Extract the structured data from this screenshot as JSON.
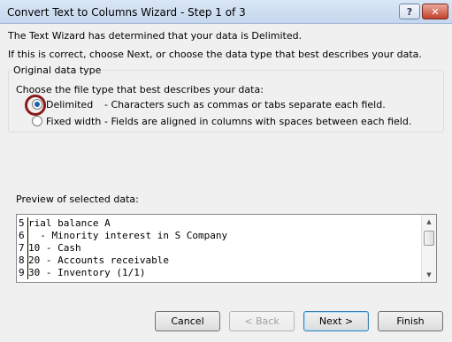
{
  "window": {
    "title": "Convert Text to Columns Wizard - Step 1 of 3",
    "help_glyph": "?",
    "close_glyph": "✕"
  },
  "intro": {
    "line1": "The Text Wizard has determined that your data is Delimited.",
    "line2": "If this is correct, choose Next, or choose the data type that best describes your data."
  },
  "data_type": {
    "legend": "Original data type",
    "prompt": "Choose the file type that best describes your data:",
    "options": [
      {
        "label": "Delimited",
        "description": "- Characters such as commas or tabs separate each field.",
        "selected": true
      },
      {
        "label": "Fixed width",
        "description": "- Fields are aligned in columns with spaces between each field.",
        "selected": false
      }
    ]
  },
  "preview": {
    "label": "Preview of selected data:",
    "rows": [
      {
        "num": "5",
        "text": "rial balance A"
      },
      {
        "num": "6",
        "text": "  - Minority interest in S Company"
      },
      {
        "num": "7",
        "text": "10 - Cash"
      },
      {
        "num": "8",
        "text": "20 - Accounts receivable"
      },
      {
        "num": "9",
        "text": "30 - Inventory (1/1)"
      }
    ]
  },
  "buttons": {
    "cancel": "Cancel",
    "back": "< Back",
    "next": "Next >",
    "finish": "Finish"
  }
}
